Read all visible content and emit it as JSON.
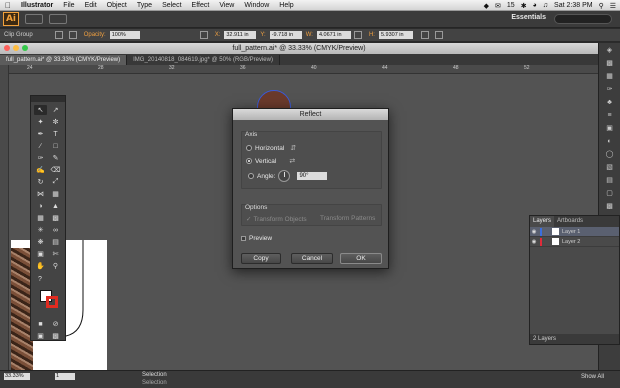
{
  "menubar": {
    "apple": "",
    "app": "Illustrator",
    "items": [
      "File",
      "Edit",
      "Object",
      "Type",
      "Select",
      "Effect",
      "View",
      "Window",
      "Help"
    ],
    "battery": "15",
    "clock": "Sat 2:38 PM"
  },
  "appbar": {
    "logo": "Ai",
    "workspace": "Essentials"
  },
  "controlbar": {
    "selection": "Clip Group",
    "opacity_label": "Opacity:",
    "opacity_value": "100%",
    "x_label": "X:",
    "x_value": "32.911 in",
    "y_label": "Y:",
    "y_value": "-9.718 in",
    "w_label": "W:",
    "w_value": "4.0671 in",
    "h_label": "H:",
    "h_value": "5.9307 in"
  },
  "document": {
    "title": "full_pattern.ai* @ 33.33% (CMYK/Preview)",
    "tabs": [
      {
        "label": "full_pattern.ai* @ 33.33% (CMYK/Preview)",
        "active": true
      },
      {
        "label": "IMG_20140818_084619.jpg* @ 50% (RGB/Preview)",
        "active": false
      }
    ],
    "ruler_numbers": [
      "24",
      "28",
      "32",
      "36",
      "40",
      "44",
      "48",
      "52"
    ]
  },
  "dialog": {
    "title": "Reflect",
    "axis_group": "Axis",
    "horizontal": "Horizontal",
    "vertical": "Vertical",
    "selected_axis": "vertical",
    "angle_label": "Angle:",
    "angle_value": "90°",
    "options_group": "Options",
    "transform_objects": "Transform Objects",
    "transform_patterns": "Transform Patterns",
    "preview": "Preview",
    "copy": "Copy",
    "cancel": "Cancel",
    "ok": "OK"
  },
  "layers": {
    "tabs": [
      "Layers",
      "Artboards"
    ],
    "rows": [
      {
        "name": "Layer 1",
        "color": "#3b6ede",
        "selected": true
      },
      {
        "name": "Layer 2",
        "color": "#e02b3a",
        "selected": false
      }
    ],
    "count": "2 Layers"
  },
  "statusbar": {
    "zoom": "33.33%",
    "page": "1",
    "selection1": "Selection",
    "selection2": "Selection",
    "show_all": "Show All"
  }
}
